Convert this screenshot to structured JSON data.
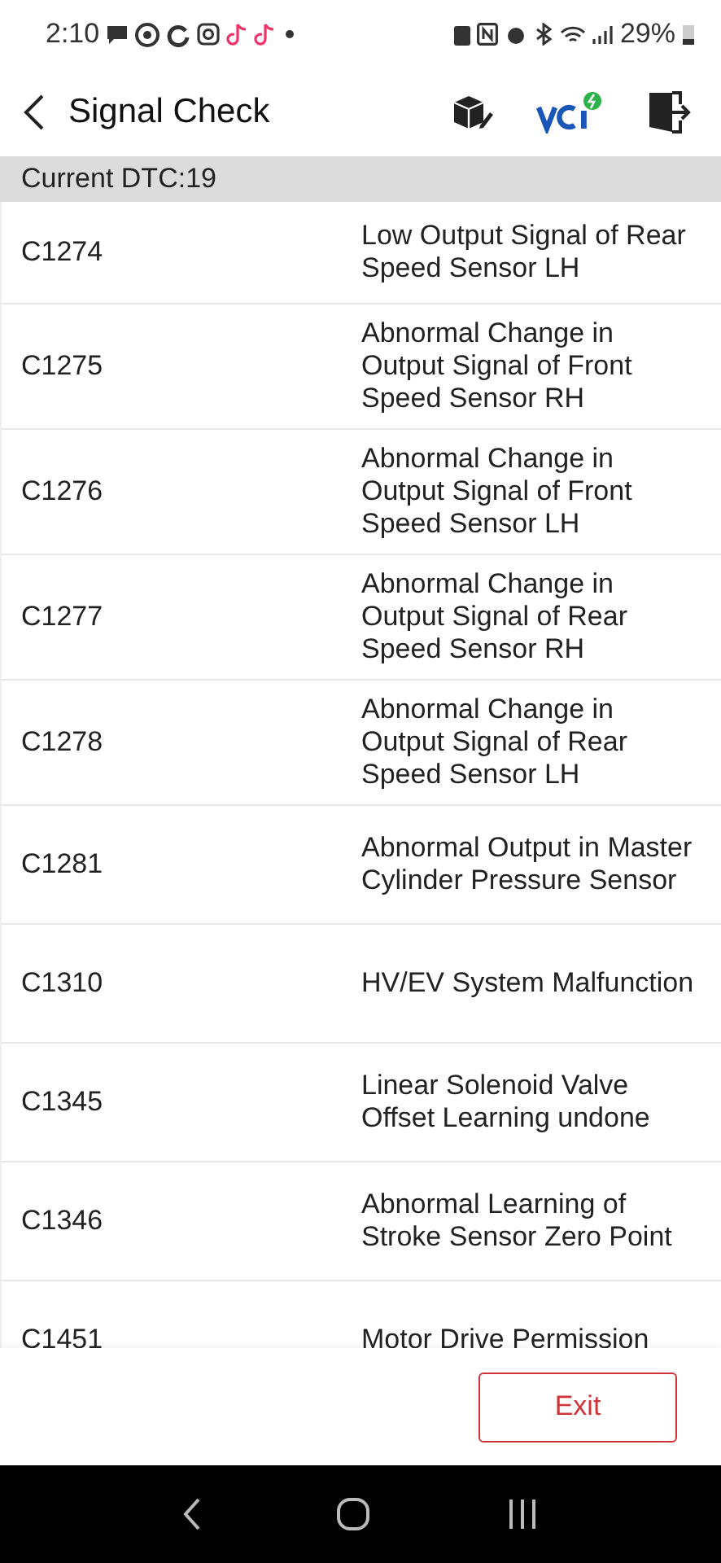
{
  "status_bar": {
    "time": "2:10",
    "battery": "29%"
  },
  "header": {
    "title": "Signal Check"
  },
  "dtc_bar": {
    "label": "Current DTC:19"
  },
  "rows": [
    {
      "code": "C1274",
      "description": "Low Output Signal of Rear Speed Sensor LH"
    },
    {
      "code": "C1275",
      "description": "Abnormal Change in Output Signal of Front Speed Sensor RH"
    },
    {
      "code": "C1276",
      "description": "Abnormal Change in Output Signal of Front Speed Sensor LH"
    },
    {
      "code": "C1277",
      "description": "Abnormal Change in Output Signal of Rear Speed Sensor RH"
    },
    {
      "code": "C1278",
      "description": "Abnormal Change in Output Signal of Rear Speed Sensor LH"
    },
    {
      "code": "C1281",
      "description": "Abnormal Output in Master Cylinder Pressure Sensor"
    },
    {
      "code": "C1310",
      "description": "HV/EV System Malfunction"
    },
    {
      "code": "C1345",
      "description": "Linear Solenoid Valve Offset Learning undone"
    },
    {
      "code": "C1346",
      "description": "Abnormal Learning of Stroke Sensor Zero Point"
    },
    {
      "code": "C1451",
      "description": "Motor Drive Permission"
    }
  ],
  "footer": {
    "button": "Exit"
  }
}
